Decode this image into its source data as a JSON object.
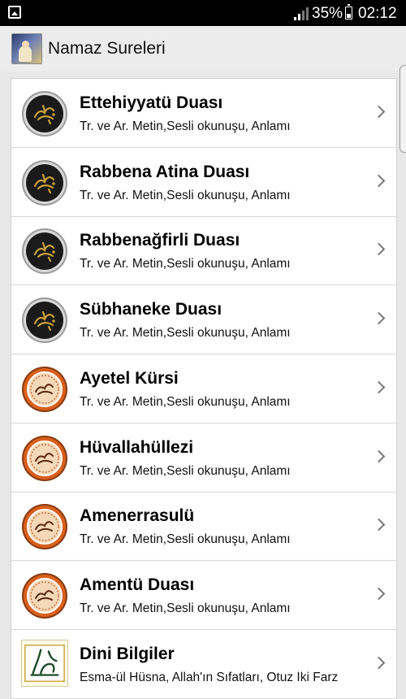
{
  "status_bar": {
    "battery_percent": "35%",
    "time": "02:12"
  },
  "app_bar": {
    "title": "Namaz Sureleri"
  },
  "list": {
    "items": [
      {
        "title": "Ettehiyyatü Duası",
        "subtitle": "Tr. ve Ar. Metin,Sesli okunuşu, Anlamı",
        "icon": "black-calligraphy-medallion-icon"
      },
      {
        "title": "Rabbena Atina Duası",
        "subtitle": "Tr. ve Ar. Metin,Sesli okunuşu, Anlamı",
        "icon": "black-calligraphy-medallion-icon"
      },
      {
        "title": "Rabbenağfirli Duası",
        "subtitle": "Tr. ve Ar. Metin,Sesli okunuşu, Anlamı",
        "icon": "black-calligraphy-medallion-icon"
      },
      {
        "title": "Sübhaneke Duası",
        "subtitle": "Tr. ve Ar. Metin,Sesli okunuşu, Anlamı",
        "icon": "black-calligraphy-medallion-icon"
      },
      {
        "title": "Ayetel Kürsi",
        "subtitle": "Tr. ve Ar. Metin,Sesli okunuşu, Anlamı",
        "icon": "orange-calligraphy-medallion-icon"
      },
      {
        "title": "Hüvallahüllezi",
        "subtitle": "Tr. ve Ar. Metin,Sesli okunuşu, Anlamı",
        "icon": "orange-calligraphy-medallion-icon"
      },
      {
        "title": "Amenerrasulü",
        "subtitle": "Tr. ve Ar. Metin,Sesli okunuşu, Anlamı",
        "icon": "orange-calligraphy-medallion-icon"
      },
      {
        "title": "Amentü Duası",
        "subtitle": "Tr. ve Ar. Metin,Sesli okunuşu, Anlamı",
        "icon": "orange-calligraphy-medallion-icon"
      },
      {
        "title": "Dini Bilgiler",
        "subtitle": "Esma-ül Hüsna, Allah'ın Sıfatları, Otuz İki Farz",
        "icon": "calligraphy-tile-icon"
      }
    ]
  },
  "colors": {
    "status_bar_bg": "#000000",
    "app_bar_bg": "#ececec",
    "list_bg": "#ffffff",
    "black_medallion": "#1a1a1a",
    "orange_medallion": "#d8601c",
    "calligraphy_gold": "#c9a23a"
  }
}
